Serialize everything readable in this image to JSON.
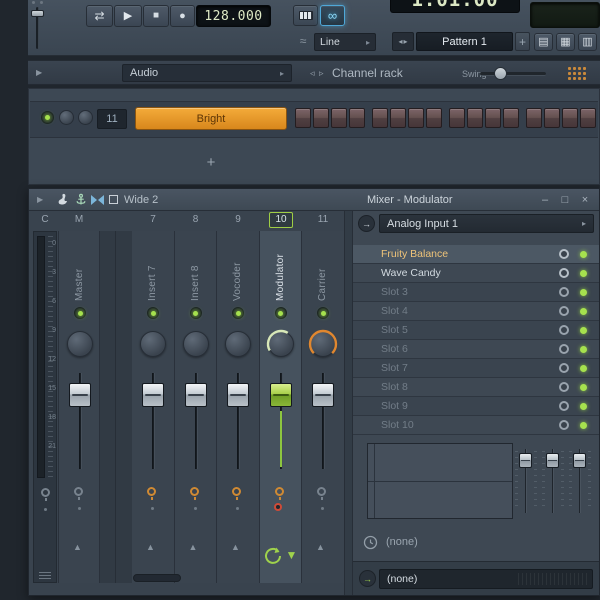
{
  "icons": {
    "loop": "⇄",
    "play": "▶",
    "stop": "■",
    "record": "●",
    "link": "∞",
    "wave": "≈",
    "menu_arrow": "▶",
    "dropdown_arrow": "▸",
    "spinner_left": "◂",
    "spinner_right": "▸",
    "rack_left": "◃",
    "rack_right": "▹",
    "minimize": "–",
    "maximize": "□",
    "close": "×",
    "up_arrow": "▲",
    "down_arrow": "▼",
    "io_arrow": "→",
    "plus": "+",
    "layout_1": "▤",
    "layout_2": "▦",
    "layout_3": "▥"
  },
  "toolbar": {
    "tempo": "128.000",
    "time": "1:01:00",
    "shape": "Line",
    "pattern": "Pattern 1"
  },
  "channel_rack": {
    "group": "Audio",
    "title": "Channel rack",
    "swing_label": "Swing",
    "channel_number": "11",
    "channel_name": "Bright",
    "add_label": "+"
  },
  "mixer": {
    "layout_label": "Wide 2",
    "title": "Mixer - Modulator",
    "headers": [
      "C",
      "M",
      "7",
      "8",
      "9",
      "10",
      "11"
    ],
    "track_names": [
      "Master",
      "Insert 7",
      "Insert 8",
      "Vocoder",
      "Modulator",
      "Carrier"
    ],
    "meter_scale": [
      "0",
      "3",
      "6",
      "9",
      "12",
      "15",
      "18",
      "21"
    ],
    "panel": {
      "input": "Analog Input 1",
      "slots": [
        "Fruity Balance",
        "Wave Candy",
        "Slot 3",
        "Slot 4",
        "Slot 5",
        "Slot 6",
        "Slot 7",
        "Slot 8",
        "Slot 9",
        "Slot 10"
      ],
      "time_control": "(none)",
      "output": "(none)"
    }
  },
  "colors": {
    "accent_orange": "#e59a35",
    "accent_green": "#9fd24c",
    "selected_fader": "#a8cf4a",
    "carrier_knob_arc": "#e0872f",
    "link_blue": "#7fd0f0"
  }
}
